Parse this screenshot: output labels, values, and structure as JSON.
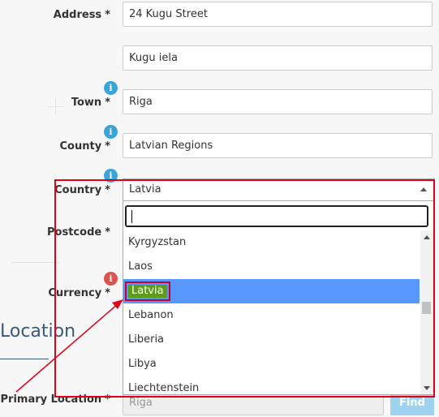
{
  "form": {
    "address": {
      "label": "Address",
      "required": "*",
      "line1": "24 Kugu Street",
      "line2": "Kugu iela"
    },
    "town": {
      "label": "Town",
      "required": "*",
      "value": "Riga",
      "info": "i"
    },
    "county": {
      "label": "County",
      "required": "*",
      "value": "Latvian Regions",
      "info": "i"
    },
    "country": {
      "label": "Country",
      "required": "*",
      "value": "Latvia",
      "info": "i"
    },
    "postcode": {
      "label": "Postcode",
      "required": "*"
    },
    "currency": {
      "label": "Currency",
      "required": "*",
      "info": "i"
    }
  },
  "dropdown": {
    "search_value": "",
    "items": [
      "Kyrgyzstan",
      "Laos",
      "Latvia",
      "Lebanon",
      "Liberia",
      "Libya",
      "Liechtenstein"
    ],
    "selected": "Latvia"
  },
  "location": {
    "section_title": "Location",
    "primary_label": "Primary Location",
    "required": "*",
    "primary_value": "Riga",
    "find_label": "Find"
  },
  "colors": {
    "highlight_box": "#e0001a",
    "selected_row": "#5897fb",
    "info_icon": "#3aa3d9"
  }
}
